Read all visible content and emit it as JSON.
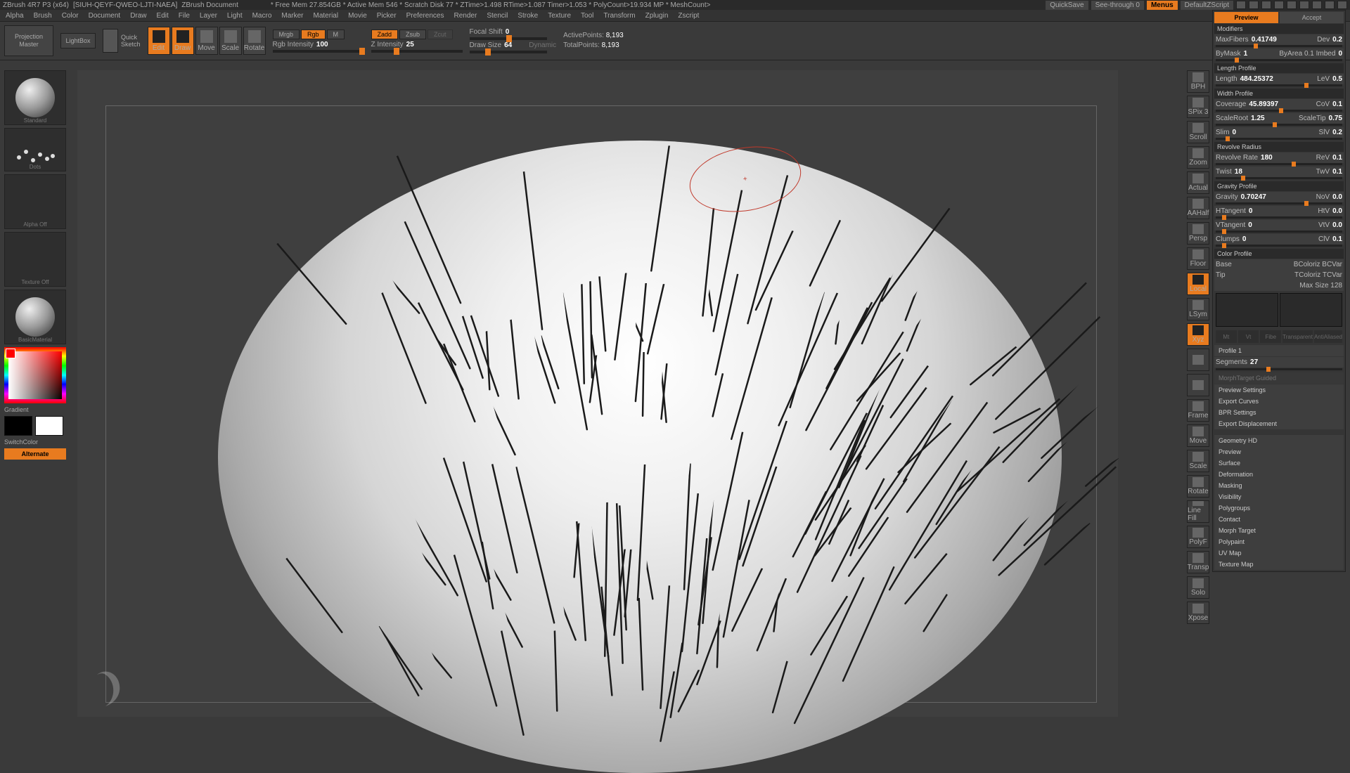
{
  "title_bar": {
    "app": "ZBrush 4R7 P3 (x64)",
    "doc": "[SIUH-QEYF-QWEO-LJTI-NAEA]",
    "doc_label": "ZBrush Document",
    "stats": "* Free Mem 27.854GB  *  Active Mem 546  *  Scratch Disk 77  *  ZTime>1.498  RTime>1.087  Timer>1.053  *  PolyCount>19.934 MP  *  MeshCount>",
    "quicksave": "QuickSave",
    "see_through": "See-through  0",
    "menus": "Menus",
    "script": "DefaultZScript"
  },
  "menus": [
    "Alpha",
    "Brush",
    "Color",
    "Document",
    "Draw",
    "Edit",
    "File",
    "Layer",
    "Light",
    "Macro",
    "Marker",
    "Material",
    "Movie",
    "Picker",
    "Preferences",
    "Render",
    "Stencil",
    "Stroke",
    "Texture",
    "Tool",
    "Transform",
    "Zplugin",
    "Zscript"
  ],
  "shelf": {
    "projection_master": "Projection\nMaster",
    "lightbox": "LightBox",
    "quick_sketch": "Quick\nSketch",
    "modes": [
      {
        "name": "edit",
        "label": "Edit",
        "on": true
      },
      {
        "name": "draw",
        "label": "Draw",
        "on": true
      },
      {
        "name": "move",
        "label": "Move",
        "on": false
      },
      {
        "name": "scale",
        "label": "Scale",
        "on": false
      },
      {
        "name": "rotate",
        "label": "Rotate",
        "on": false
      }
    ],
    "mrgb": "Mrgb",
    "rgb": "Rgb",
    "m": "M",
    "rgb_intensity_label": "Rgb Intensity",
    "rgb_intensity": "100",
    "zadd": "Zadd",
    "zsub": "Zsub",
    "zcut": "Zcut",
    "z_intensity_label": "Z Intensity",
    "z_intensity": "25",
    "focal_shift_label": "Focal Shift",
    "focal_shift": "0",
    "draw_size_label": "Draw Size",
    "draw_size": "64",
    "dynamic": "Dynamic",
    "active_label": "ActivePoints:",
    "active_val": "8,193",
    "total_label": "TotalPoints:",
    "total_val": "8,193"
  },
  "left": {
    "brush_name": "Standard",
    "stroke_name": "Dots",
    "alpha_name": "Alpha Off",
    "texture_name": "Texture Off",
    "material_name": "BasicMaterial",
    "gradient": "Gradient",
    "switch": "SwitchColor",
    "alternate": "Alternate"
  },
  "rnav": [
    {
      "name": "bph",
      "label": "BPH"
    },
    {
      "name": "spix",
      "label": "SPix 3"
    },
    {
      "name": "scroll",
      "label": "Scroll"
    },
    {
      "name": "zoom",
      "label": "Zoom"
    },
    {
      "name": "actual",
      "label": "Actual"
    },
    {
      "name": "aahalf",
      "label": "AAHalf"
    },
    {
      "name": "persp",
      "label": "Persp"
    },
    {
      "name": "floor",
      "label": "Floor"
    },
    {
      "name": "local",
      "label": "Local",
      "on": true
    },
    {
      "name": "lsym",
      "label": "LSym"
    },
    {
      "name": "xyz",
      "label": "Xyz",
      "on": true
    },
    {
      "name": "m1",
      "label": ""
    },
    {
      "name": "m2",
      "label": ""
    },
    {
      "name": "frame",
      "label": "Frame"
    },
    {
      "name": "move3d",
      "label": "Move"
    },
    {
      "name": "scale3d",
      "label": "Scale"
    },
    {
      "name": "rotate3d",
      "label": "Rotate"
    },
    {
      "name": "linefill",
      "label": "Line Fill"
    },
    {
      "name": "pf",
      "label": "PolyF"
    },
    {
      "name": "transp",
      "label": "Transp"
    },
    {
      "name": "solo",
      "label": "Solo"
    },
    {
      "name": "xpose",
      "label": "Xpose"
    }
  ],
  "props": {
    "tabs": {
      "preview": "Preview",
      "accept": "Accept"
    },
    "modifiers_hd": "Modifiers",
    "rows": [
      {
        "k": "MaxFibers",
        "v": "0.41749",
        "k2": "Dev",
        "v2": "0.2",
        "knob": 30
      },
      {
        "k": "ByMask",
        "v": "1",
        "k2": "ByArea 0.1   Imbed",
        "v2": "0",
        "knob": 15
      }
    ],
    "length_hd": "Length Profile",
    "length_rows": [
      {
        "k": "Length",
        "v": "484.25372",
        "k2": "LeV",
        "v2": "0.5",
        "knob": 70
      }
    ],
    "width_hd": "Width Profile",
    "width_rows": [
      {
        "k": "Coverage",
        "v": "45.89397",
        "k2": "CoV",
        "v2": "0.1",
        "knob": 50
      },
      {
        "k": "ScaleRoot",
        "v": "1.25",
        "k2": "ScaleTip",
        "v2": "0.75",
        "knob": 45
      },
      {
        "k": "Slim",
        "v": "0",
        "k2": "SlV",
        "v2": "0.2",
        "knob": 8
      }
    ],
    "revolve_hd": "Revolve Radius",
    "revolve_rows": [
      {
        "k": "Revolve Rate",
        "v": "180",
        "k2": "ReV",
        "v2": "0.1",
        "knob": 60
      },
      {
        "k": "Twist",
        "v": "18",
        "k2": "TwV",
        "v2": "0.1",
        "knob": 20
      }
    ],
    "gravity_hd": "Gravity Profile",
    "gravity_rows": [
      {
        "k": "Gravity",
        "v": "0.70247",
        "k2": "NoV",
        "v2": "0.0",
        "knob": 70
      },
      {
        "k": "HTangent",
        "v": "0",
        "k2": "HtV",
        "v2": "0.0",
        "knob": 5
      },
      {
        "k": "VTangent",
        "v": "0",
        "k2": "VtV",
        "v2": "0.0",
        "knob": 5
      },
      {
        "k": "Clumps",
        "v": "0",
        "k2": "ClV",
        "v2": "0.1",
        "knob": 5
      }
    ],
    "color_hd": "Color Profile",
    "color_rows": [
      {
        "l": "Base",
        "r": "BColoriz BCVar"
      },
      {
        "l": "Tip",
        "r": "TColoriz TCVar"
      },
      {
        "l": "",
        "r": "Max Size 128"
      }
    ],
    "fiber_labels": [
      "Mt",
      "Vt",
      "Fibe",
      "Transparent",
      "AntiAliased"
    ],
    "profile": "Profile 1",
    "segments_k": "Segments",
    "segments_v": "27",
    "morph": "MorphTarget Guided",
    "sections": [
      "Preview Settings",
      "Export Curves",
      "BPR Settings",
      "Export Displacement"
    ],
    "bottom": [
      "Geometry HD",
      "Preview",
      "Surface",
      "Deformation",
      "Masking",
      "Visibility",
      "Polygroups",
      "Contact",
      "Morph Target",
      "Polypaint",
      "UV Map",
      "Texture Map"
    ]
  }
}
